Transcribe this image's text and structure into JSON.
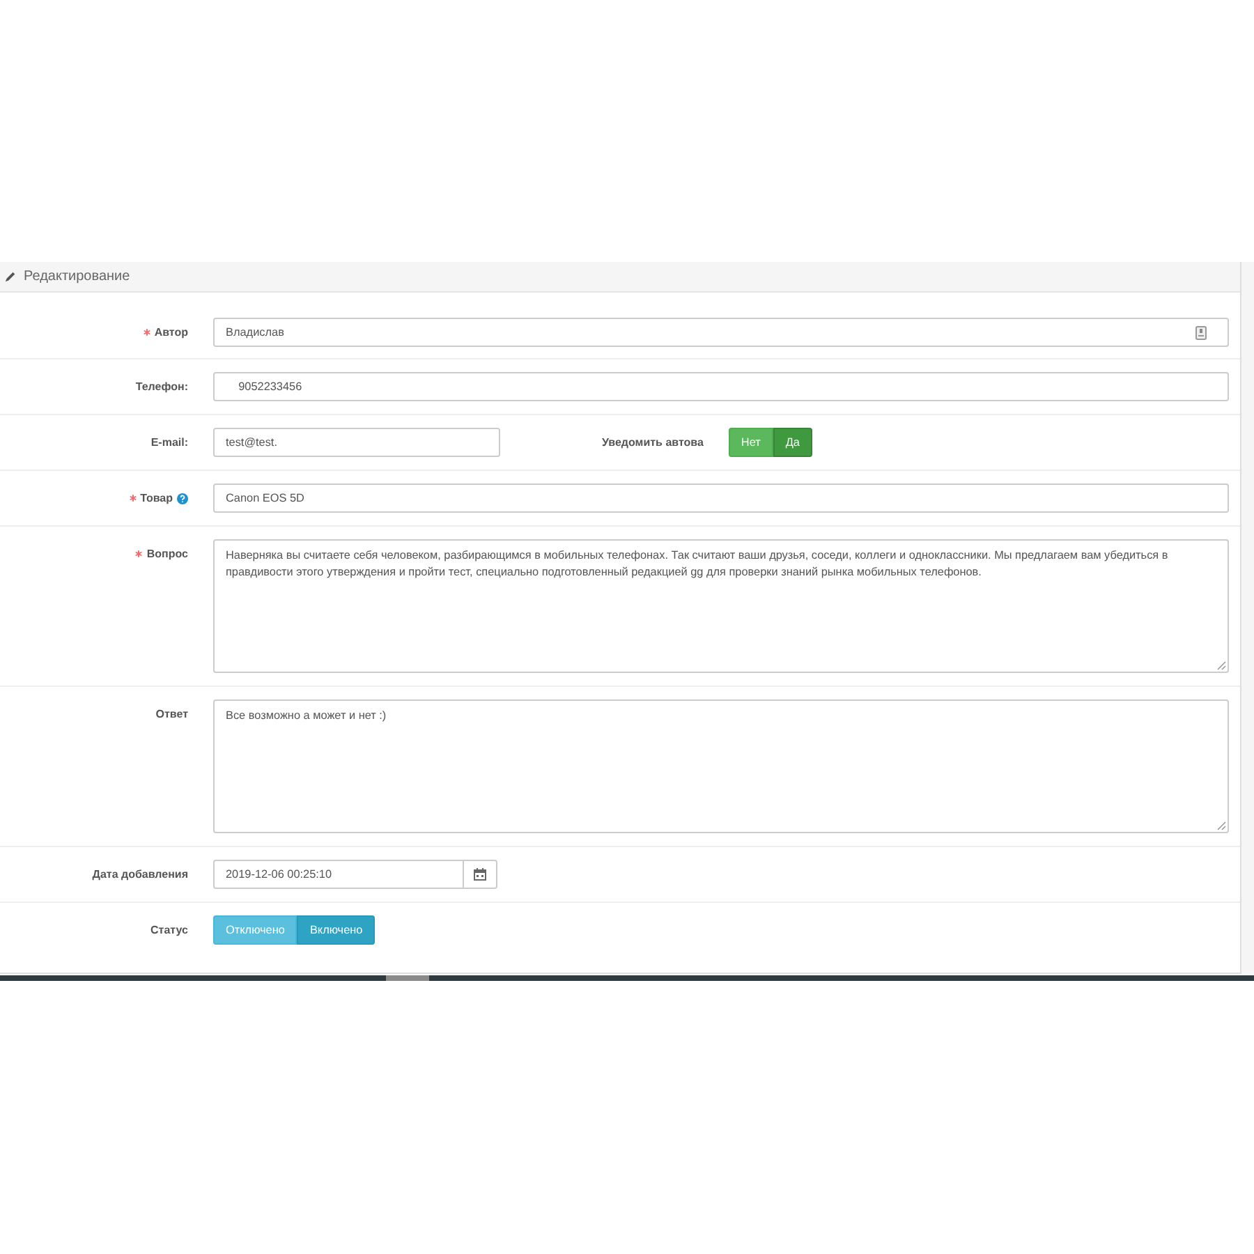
{
  "panel": {
    "title": "Редактирование"
  },
  "fields": [
    {
      "kind": "text",
      "label": "Автор",
      "required": true,
      "help": false,
      "autofill": true,
      "value": "Владислав"
    },
    {
      "kind": "text",
      "label": "Телефон:",
      "required": false,
      "help": false,
      "autofill": false,
      "value": "    9052233456"
    },
    {
      "kind": "email",
      "label": "E-mail:",
      "required": false,
      "help": false,
      "value": "test@test.",
      "notify": {
        "label": "Уведомить автова",
        "options": [
          {
            "label": "Нет",
            "selected": false
          },
          {
            "label": "Да",
            "selected": true
          }
        ]
      }
    },
    {
      "kind": "text",
      "label": "Товар",
      "required": true,
      "help": true,
      "autofill": false,
      "value": "Canon EOS 5D"
    },
    {
      "kind": "textarea",
      "label": "Вопрос",
      "required": true,
      "help": false,
      "value": "Наверняка вы считаете себя человеком, разбирающимся в мобильных телефонах. Так считают ваши друзья, соседи, коллеги и одноклассники. Мы предлагаем вам убедиться в правдивости этого утверждения и пройти тест, специально подготовленный редакцией gg для проверки знаний рынка мобильных телефонов."
    },
    {
      "kind": "textarea",
      "label": "Ответ",
      "required": false,
      "help": false,
      "value": "Все возможно а может и нет :)"
    },
    {
      "kind": "date",
      "label": "Дата добавления",
      "required": false,
      "help": false,
      "value": "2019-12-06 00:25:10"
    },
    {
      "kind": "toggle",
      "label": "Статус",
      "required": false,
      "help": false,
      "options": [
        {
          "label": "Отключено",
          "selected": false
        },
        {
          "label": "Включено",
          "selected": true
        }
      ]
    }
  ]
}
